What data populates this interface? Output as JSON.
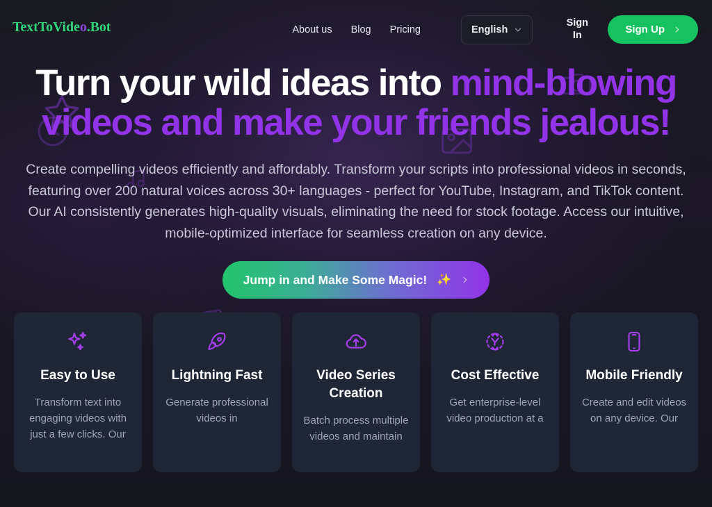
{
  "brand": {
    "name_part1": "TextToVide",
    "name_accent": "o",
    "name_part2": ".Bot",
    "green": "#2fd47a",
    "purple": "#8b45d4"
  },
  "header": {
    "nav": [
      {
        "label": "About us"
      },
      {
        "label": "Blog"
      },
      {
        "label": "Pricing"
      }
    ],
    "language": {
      "selected": "English",
      "options": [
        "English"
      ]
    },
    "sign_in_label": "Sign In",
    "sign_up_label": "Sign Up"
  },
  "hero": {
    "headline_white": "Turn your wild ideas into ",
    "headline_accent": "mind-blowing videos and make your friends jealous!",
    "subhead": "Create compelling videos efficiently and affordably. Transform your scripts into professional videos in seconds, featuring over 200 natural voices across 30+ languages - perfect for YouTube, Instagram, and TikTok content. Our AI consistently generates high-quality visuals, eliminating the need for stock footage. Access our intuitive, mobile-optimized interface for seamless creation on any device.",
    "cta_label": "Jump in and Make Some Magic!",
    "cta_sparkle": "✨",
    "accent_color": "#9233e8",
    "cta_gradient_start": "#22c46b",
    "cta_gradient_end": "#9233e8"
  },
  "features": [
    {
      "icon": "sparkles-icon",
      "title": "Easy to Use",
      "text": "Transform text into engaging videos with just a few clicks. Our"
    },
    {
      "icon": "rocket-icon",
      "title": "Lightning Fast",
      "text": "Generate professional videos in"
    },
    {
      "icon": "cloud-upload-icon",
      "title": "Video Series Creation",
      "text": "Batch process multiple videos and maintain"
    },
    {
      "icon": "shuffle-circle-icon",
      "title": "Cost Effective",
      "text": "Get enterprise-level video production at a"
    },
    {
      "icon": "mobile-phone-icon",
      "title": "Mobile Friendly",
      "text": "Create and edit videos on any device. Our"
    }
  ],
  "decorations": [
    {
      "name": "star-outline-icon"
    },
    {
      "name": "clock-outline-icon"
    },
    {
      "name": "music-note-icon"
    },
    {
      "name": "video-camera-icon"
    },
    {
      "name": "film-strip-icon"
    },
    {
      "name": "image-placeholder-icon"
    },
    {
      "name": "camera-icon"
    },
    {
      "name": "heart-emoji-icon"
    }
  ]
}
